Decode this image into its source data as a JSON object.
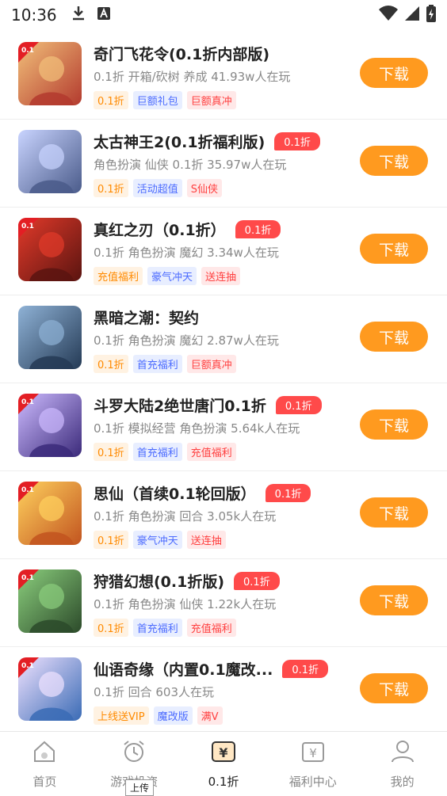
{
  "status": {
    "time": "10:36"
  },
  "games": [
    {
      "title": "奇门飞花令(0.1折内部版)",
      "discount": "",
      "meta": "0.1折 开箱/砍树 养成  41.93w人在玩",
      "tags": [
        "0.1折",
        "巨额礼包",
        "巨额真冲"
      ],
      "button": "下载"
    },
    {
      "title": "太古神王2(0.1折福利版)",
      "discount": "0.1折",
      "meta": "角色扮演 仙侠 0.1折  35.97w人在玩",
      "tags": [
        "0.1折",
        "活动超值",
        "S仙侠"
      ],
      "button": "下载"
    },
    {
      "title": "真红之刃（0.1折）",
      "discount": "0.1折",
      "meta": "0.1折 角色扮演 魔幻  3.34w人在玩",
      "tags": [
        "充值福利",
        "豪气冲天",
        "送连抽"
      ],
      "button": "下载"
    },
    {
      "title": "黑暗之潮：契约",
      "discount": "",
      "meta": "0.1折 角色扮演 魔幻  2.87w人在玩",
      "tags": [
        "0.1折",
        "首充福利",
        "巨额真冲"
      ],
      "button": "下载"
    },
    {
      "title": "斗罗大陆2绝世唐门0.1折",
      "discount": "0.1折",
      "meta": "0.1折 模拟经营 角色扮演  5.64k人在玩",
      "tags": [
        "0.1折",
        "首充福利",
        "充值福利"
      ],
      "button": "下载"
    },
    {
      "title": "思仙（首续0.1轮回版）",
      "discount": "0.1折",
      "meta": "0.1折 角色扮演 回合  3.05k人在玩",
      "tags": [
        "0.1折",
        "豪气冲天",
        "送连抽"
      ],
      "button": "下载"
    },
    {
      "title": "狩猎幻想(0.1折版)",
      "discount": "0.1折",
      "meta": "0.1折 角色扮演 仙侠  1.22k人在玩",
      "tags": [
        "0.1折",
        "首充福利",
        "充值福利"
      ],
      "button": "下载"
    },
    {
      "title": "仙语奇缘（内置0.1魔改...",
      "discount": "0.1折",
      "meta": "0.1折 回合  603人在玩",
      "tags": [
        "上线送VIP",
        "魔改版",
        "满V"
      ],
      "button": "下载"
    }
  ],
  "tabs": [
    {
      "label": "首页"
    },
    {
      "label": "游戏投资"
    },
    {
      "label": "0.1折"
    },
    {
      "label": "福利中心"
    },
    {
      "label": "我的"
    }
  ],
  "tooltip": "上传"
}
